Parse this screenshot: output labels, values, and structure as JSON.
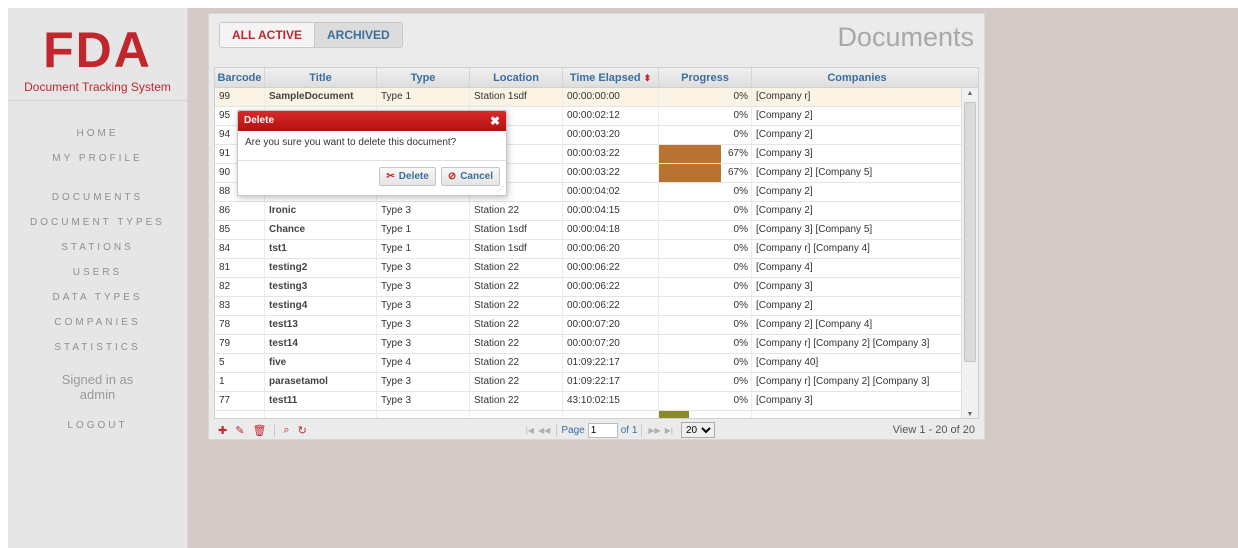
{
  "app": {
    "logo": "FDA",
    "subtitle": "Document Tracking System"
  },
  "sidebar": {
    "top": [
      "HOME",
      "MY PROFILE"
    ],
    "main": [
      "DOCUMENTS",
      "DOCUMENT TYPES",
      "STATIONS",
      "USERS",
      "DATA TYPES",
      "COMPANIES",
      "STATISTICS"
    ],
    "signed_line1": "Signed in as",
    "signed_line2": "admin",
    "logout": "LOGOUT"
  },
  "tabs": {
    "active": "ALL ACTIVE",
    "archived": "ARCHIVED"
  },
  "page_title": "Documents",
  "grid": {
    "columns": [
      "Barcode",
      "Title",
      "Type",
      "Location",
      "Time Elapsed",
      "Progress",
      "Companies"
    ],
    "sort_indicator": "⬍",
    "rows": [
      {
        "barcode": "99",
        "title": "SampleDocument",
        "type": "Type 1",
        "location": "Station 1sdf",
        "time": "00:00:00:00",
        "progress": 0,
        "progress_label": "0%",
        "companies": "[Company r]"
      },
      {
        "barcode": "95",
        "title": "",
        "type": "",
        "location": "2",
        "time": "00:00:02:12",
        "progress": 0,
        "progress_label": "0%",
        "companies": "[Company 2]"
      },
      {
        "barcode": "94",
        "title": "",
        "type": "",
        "location": "2",
        "time": "00:00:03:20",
        "progress": 0,
        "progress_label": "0%",
        "companies": "[Company 2]"
      },
      {
        "barcode": "91",
        "title": "",
        "type": "",
        "location": "3",
        "time": "00:00:03:22",
        "progress": 67,
        "progress_label": "67%",
        "companies": "[Company 3]"
      },
      {
        "barcode": "90",
        "title": "",
        "type": "",
        "location": "3",
        "time": "00:00:03:22",
        "progress": 67,
        "progress_label": "67%",
        "companies": "[Company 2] [Company 5]"
      },
      {
        "barcode": "88",
        "title": "",
        "type": "",
        "location": "2",
        "time": "00:00:04:02",
        "progress": 0,
        "progress_label": "0%",
        "companies": "[Company 2]"
      },
      {
        "barcode": "86",
        "title": "Ironic",
        "type": "Type 3",
        "location": "Station 22",
        "time": "00:00:04:15",
        "progress": 0,
        "progress_label": "0%",
        "companies": "[Company 2]"
      },
      {
        "barcode": "85",
        "title": "Chance",
        "type": "Type 1",
        "location": "Station 1sdf",
        "time": "00:00:04:18",
        "progress": 0,
        "progress_label": "0%",
        "companies": "[Company 3] [Company 5]"
      },
      {
        "barcode": "84",
        "title": "tst1",
        "type": "Type 1",
        "location": "Station 1sdf",
        "time": "00:00:06:20",
        "progress": 0,
        "progress_label": "0%",
        "companies": "[Company r] [Company 4]"
      },
      {
        "barcode": "81",
        "title": "testing2",
        "type": "Type 3",
        "location": "Station 22",
        "time": "00:00:06:22",
        "progress": 0,
        "progress_label": "0%",
        "companies": "[Company 4]"
      },
      {
        "barcode": "82",
        "title": "testing3",
        "type": "Type 3",
        "location": "Station 22",
        "time": "00:00:06:22",
        "progress": 0,
        "progress_label": "0%",
        "companies": "[Company 3]"
      },
      {
        "barcode": "83",
        "title": "testing4",
        "type": "Type 3",
        "location": "Station 22",
        "time": "00:00:06:22",
        "progress": 0,
        "progress_label": "0%",
        "companies": "[Company 2]"
      },
      {
        "barcode": "78",
        "title": "test13",
        "type": "Type 3",
        "location": "Station 22",
        "time": "00:00:07:20",
        "progress": 0,
        "progress_label": "0%",
        "companies": "[Company 2] [Company 4]"
      },
      {
        "barcode": "79",
        "title": "test14",
        "type": "Type 3",
        "location": "Station 22",
        "time": "00:00:07:20",
        "progress": 0,
        "progress_label": "0%",
        "companies": "[Company r] [Company 2] [Company 3]"
      },
      {
        "barcode": "5",
        "title": "five",
        "type": "Type 4",
        "location": "Station 22",
        "time": "01:09:22:17",
        "progress": 0,
        "progress_label": "0%",
        "companies": "[Company 40]"
      },
      {
        "barcode": "1",
        "title": "parasetamol",
        "type": "Type 3",
        "location": "Station 22",
        "time": "01:09:22:17",
        "progress": 0,
        "progress_label": "0%",
        "companies": "[Company r] [Company 2] [Company 3]"
      },
      {
        "barcode": "77",
        "title": "test11",
        "type": "Type 3",
        "location": "Station 22",
        "time": "43:10:02:15",
        "progress": 0,
        "progress_label": "0%",
        "companies": "[Company 3]"
      },
      {
        "barcode": "",
        "title": "",
        "type": "",
        "location": "",
        "time": "",
        "progress": 33,
        "progress_label": "",
        "companies": ""
      }
    ],
    "bar_colors": {
      "orange": "#b87333",
      "olive": "#8a8a2a"
    }
  },
  "pager": {
    "page_label": "Page",
    "page_value": "1",
    "of_label": "of 1",
    "page_size": "20",
    "page_size_options": [
      "20"
    ],
    "view_info": "View 1 - 20 of 20"
  },
  "modal": {
    "title": "Delete",
    "message": "Are you sure you want to delete this document?",
    "delete_label": "Delete",
    "cancel_label": "Cancel"
  }
}
